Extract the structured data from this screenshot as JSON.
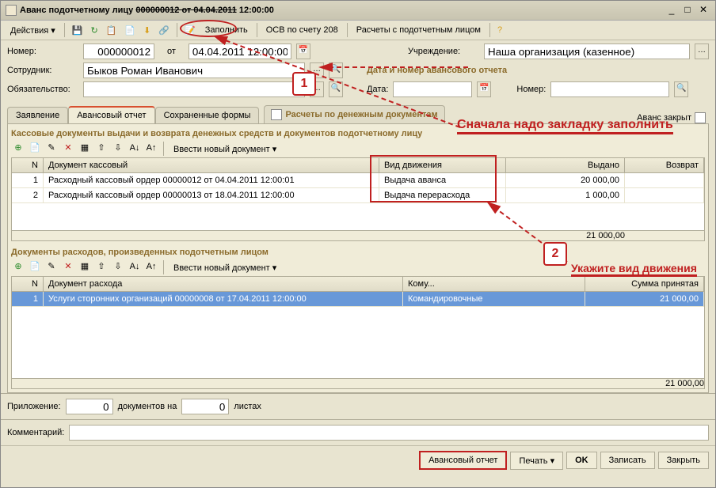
{
  "title_prefix": "Аванс подотчетному лицу ",
  "title_num": "000000012 от 04.04.2011",
  "title_time": " 12:00:00",
  "toolbar": {
    "actions": "Действия",
    "fill": "Заполнить",
    "osv": "ОСВ по счету 208",
    "calc": "Расчеты с подотчетным лицом"
  },
  "form": {
    "number_label": "Номер:",
    "number": "000000012",
    "from": "от",
    "date": "04.04.2011 12:00:00",
    "org_label": "Учреждение:",
    "org": "Наша организация (казенное)",
    "employee_label": "Сотрудник:",
    "employee": "Быков Роман Иванович",
    "report_title": "Дата и номер авансового отчета",
    "date2_label": "Дата:",
    "number2_label": "Номер:",
    "oblig_label": "Обязательство:"
  },
  "tabs": {
    "t1": "Заявление",
    "t2": "Авансовый отчет",
    "t3": "Сохраненные формы",
    "t4": "Расчеты по денежным документам",
    "closed": "Аванс закрыт"
  },
  "sub1": "Кассовые документы выдачи и возврата денежных средств и документов подотчетному лицу",
  "sub2": "Документы расходов, произведенных подотчетным лицом",
  "grid_toolbar": {
    "new_doc": "Ввести новый документ"
  },
  "grid1": {
    "head": {
      "n": "N",
      "doc": "Документ кассовый",
      "vid": "Вид движения",
      "vyd": "Выдано",
      "voz": "Возврат"
    },
    "rows": [
      {
        "n": "1",
        "doc": "Расходный кассовый ордер 00000012 от 04.04.2011 12:00:01",
        "vid": "Выдача аванса",
        "vyd": "20 000,00",
        "voz": ""
      },
      {
        "n": "2",
        "doc": "Расходный кассовый ордер 00000013 от 18.04.2011 12:00:00",
        "vid": "Выдача перерасхода",
        "vyd": "1 000,00",
        "voz": ""
      }
    ],
    "total_vyd": "21 000,00"
  },
  "grid2": {
    "head": {
      "n": "N",
      "doc": "Документ расхода",
      "kom": "Кому...",
      "sum": "Сумма принятая"
    },
    "rows": [
      {
        "n": "1",
        "doc": "Услуги сторонних организаций 00000008 от 17.04.2011 12:00:00",
        "kom": "Командировочные",
        "sum": "21 000,00"
      }
    ],
    "total_sum": "21 000,00"
  },
  "footer": {
    "att_label": "Приложение:",
    "att_val": "0",
    "doc_on": "документов на",
    "sheets_val": "0",
    "sheets": "листах",
    "comment_label": "Комментарий:"
  },
  "bottom": {
    "report": "Авансовый отчет",
    "print": "Печать",
    "ok": "OK",
    "save": "Записать",
    "close": "Закрыть"
  },
  "anno": {
    "n1": "1",
    "n2": "2",
    "text1": "Сначала надо закладку заполнить",
    "text2": "Укажите вид движения"
  }
}
